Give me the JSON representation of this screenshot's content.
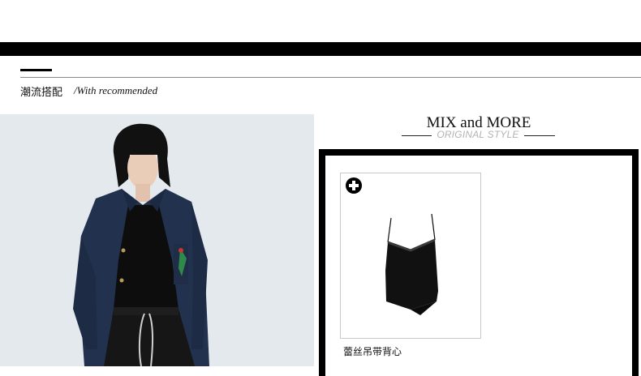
{
  "section": {
    "title": "潮流搭配",
    "subtitle": "/With recommended"
  },
  "mix": {
    "title": "MIX and MORE",
    "subtitle": "ORIGINAL STYLE"
  },
  "products": [
    {
      "name": "蕾丝吊带背心",
      "icon": "plus-icon"
    }
  ],
  "colors": {
    "bar": "#000000",
    "subtitle_gray": "#b3b3b3",
    "card_border": "#c9c9c9"
  }
}
